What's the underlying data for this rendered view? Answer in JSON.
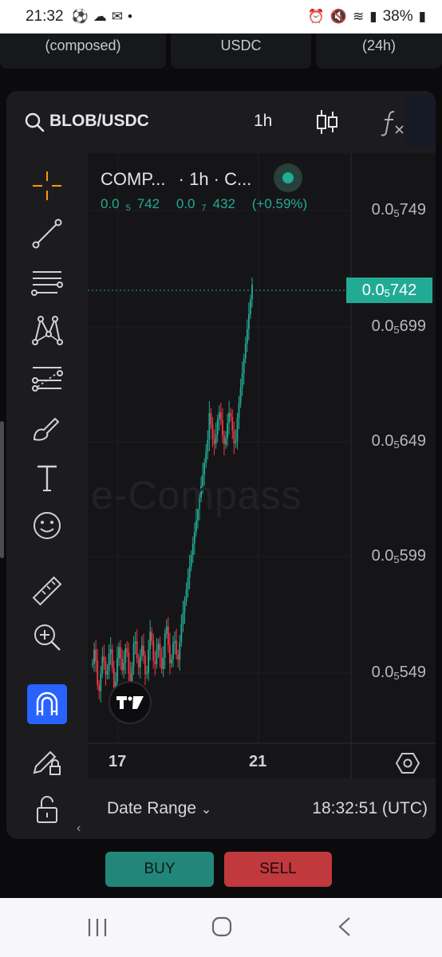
{
  "status_bar": {
    "time": "21:32",
    "battery": "38%"
  },
  "top_cards": [
    "(composed)",
    "USDC",
    "(24h)"
  ],
  "toolbar": {
    "symbol": "BLOB/USDC",
    "interval": "1h"
  },
  "legend": {
    "title": "COMP...",
    "meta": "· 1h · C...",
    "price_lead": "0.0",
    "price_sub": "5",
    "price_tail": "742",
    "change_lead": "0.0",
    "change_sub": "7",
    "change_tail": "432",
    "change_pct": "(+0.59%)"
  },
  "watermark": "e-Compass",
  "price_axis": [
    {
      "lead": "0.0",
      "sub": "5",
      "tail": "749"
    },
    {
      "lead": "0.0",
      "sub": "5",
      "tail": "699"
    },
    {
      "lead": "0.0",
      "sub": "5",
      "tail": "649"
    },
    {
      "lead": "0.0",
      "sub": "5",
      "tail": "599"
    },
    {
      "lead": "0.0",
      "sub": "5",
      "tail": "549"
    }
  ],
  "current_price": {
    "lead": "0.0",
    "sub": "5",
    "tail": "742"
  },
  "time_axis": [
    "17",
    "21"
  ],
  "bottom": {
    "date_range": "Date Range",
    "clock": "18:32:51 (UTC)"
  },
  "actions": {
    "buy": "BUY",
    "sell": "SELL"
  },
  "colors": {
    "up": "#22ab94",
    "down": "#f23645",
    "accent": "#2962ff"
  }
}
